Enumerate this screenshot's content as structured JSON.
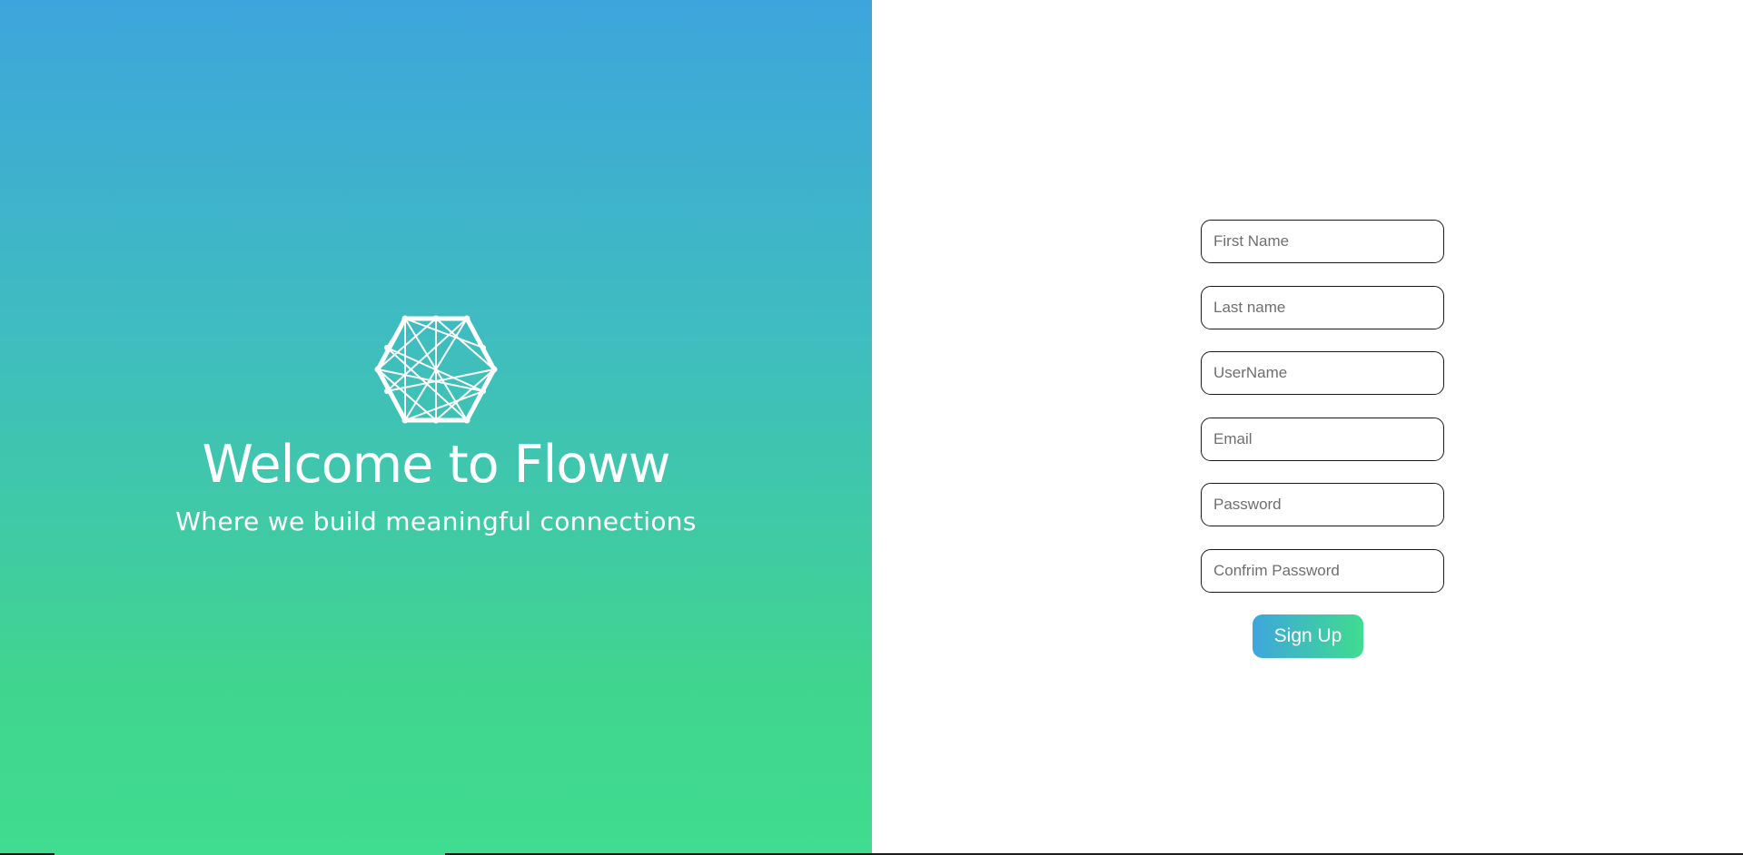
{
  "hero": {
    "logo_icon": "hexagon-network-icon",
    "title": "Welcome to Floww",
    "tagline": "Where we build meaningful connections",
    "gradient_colors": [
      "#3ea5dc",
      "#40dc8f"
    ]
  },
  "signup_form": {
    "first_name": {
      "placeholder": "First Name",
      "value": ""
    },
    "last_name": {
      "placeholder": "Last name",
      "value": ""
    },
    "username": {
      "placeholder": "UserName",
      "value": ""
    },
    "email": {
      "placeholder": "Email",
      "value": ""
    },
    "password": {
      "placeholder": "Password",
      "value": ""
    },
    "confirm_password": {
      "placeholder": "Confrim Password",
      "value": ""
    },
    "submit_label": "Sign Up"
  },
  "colors": {
    "accent_start": "#3ea6dc",
    "accent_end": "#40dc8f",
    "field_border": "#1a1a1a"
  }
}
